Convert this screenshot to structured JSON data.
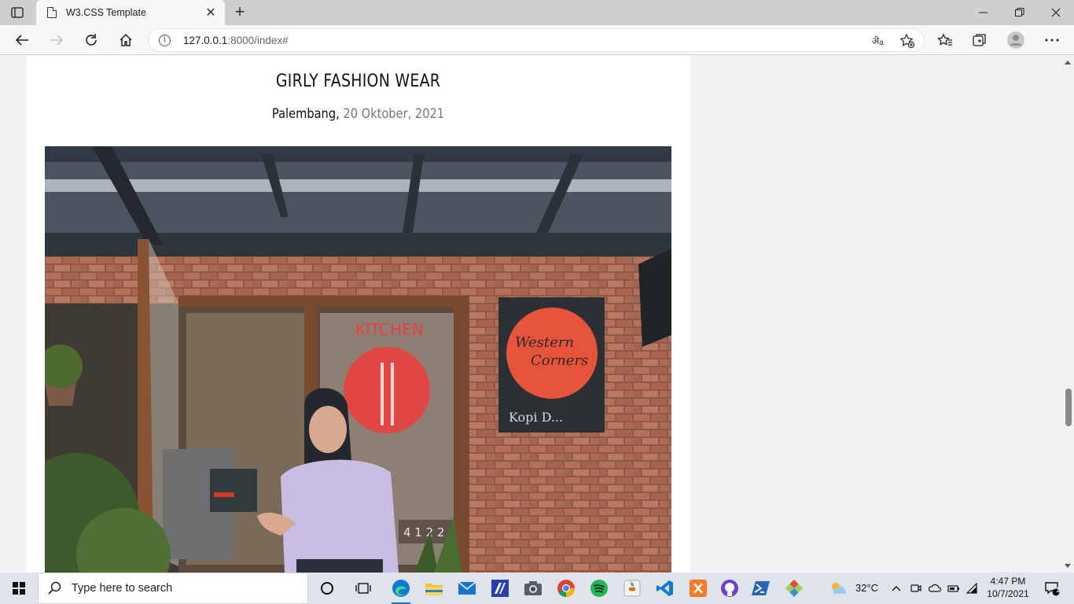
{
  "browser": {
    "tab_title": "W3.CSS Template",
    "url_host": "127.0.0.1",
    "url_path": ":8000/index#"
  },
  "post": {
    "title": "GIRLY FASHION WEAR",
    "location": "Palembang,",
    "date": "20 Oktober, 2021"
  },
  "photo": {
    "window_sign": "KITCHEN",
    "wall_sign_line1": "Western",
    "wall_sign_line2": "Corners",
    "wall_sign_bottom": "Kopi D...",
    "counter_numbers": "4 1 2 2"
  },
  "taskbar": {
    "search_placeholder": "Type here to search",
    "weather": "32°C",
    "time": "4:47 PM",
    "date": "10/7/2021",
    "notifications": "1"
  },
  "colors": {
    "edge_blue": "#0b7ad1",
    "sign_red": "#e8403f"
  }
}
